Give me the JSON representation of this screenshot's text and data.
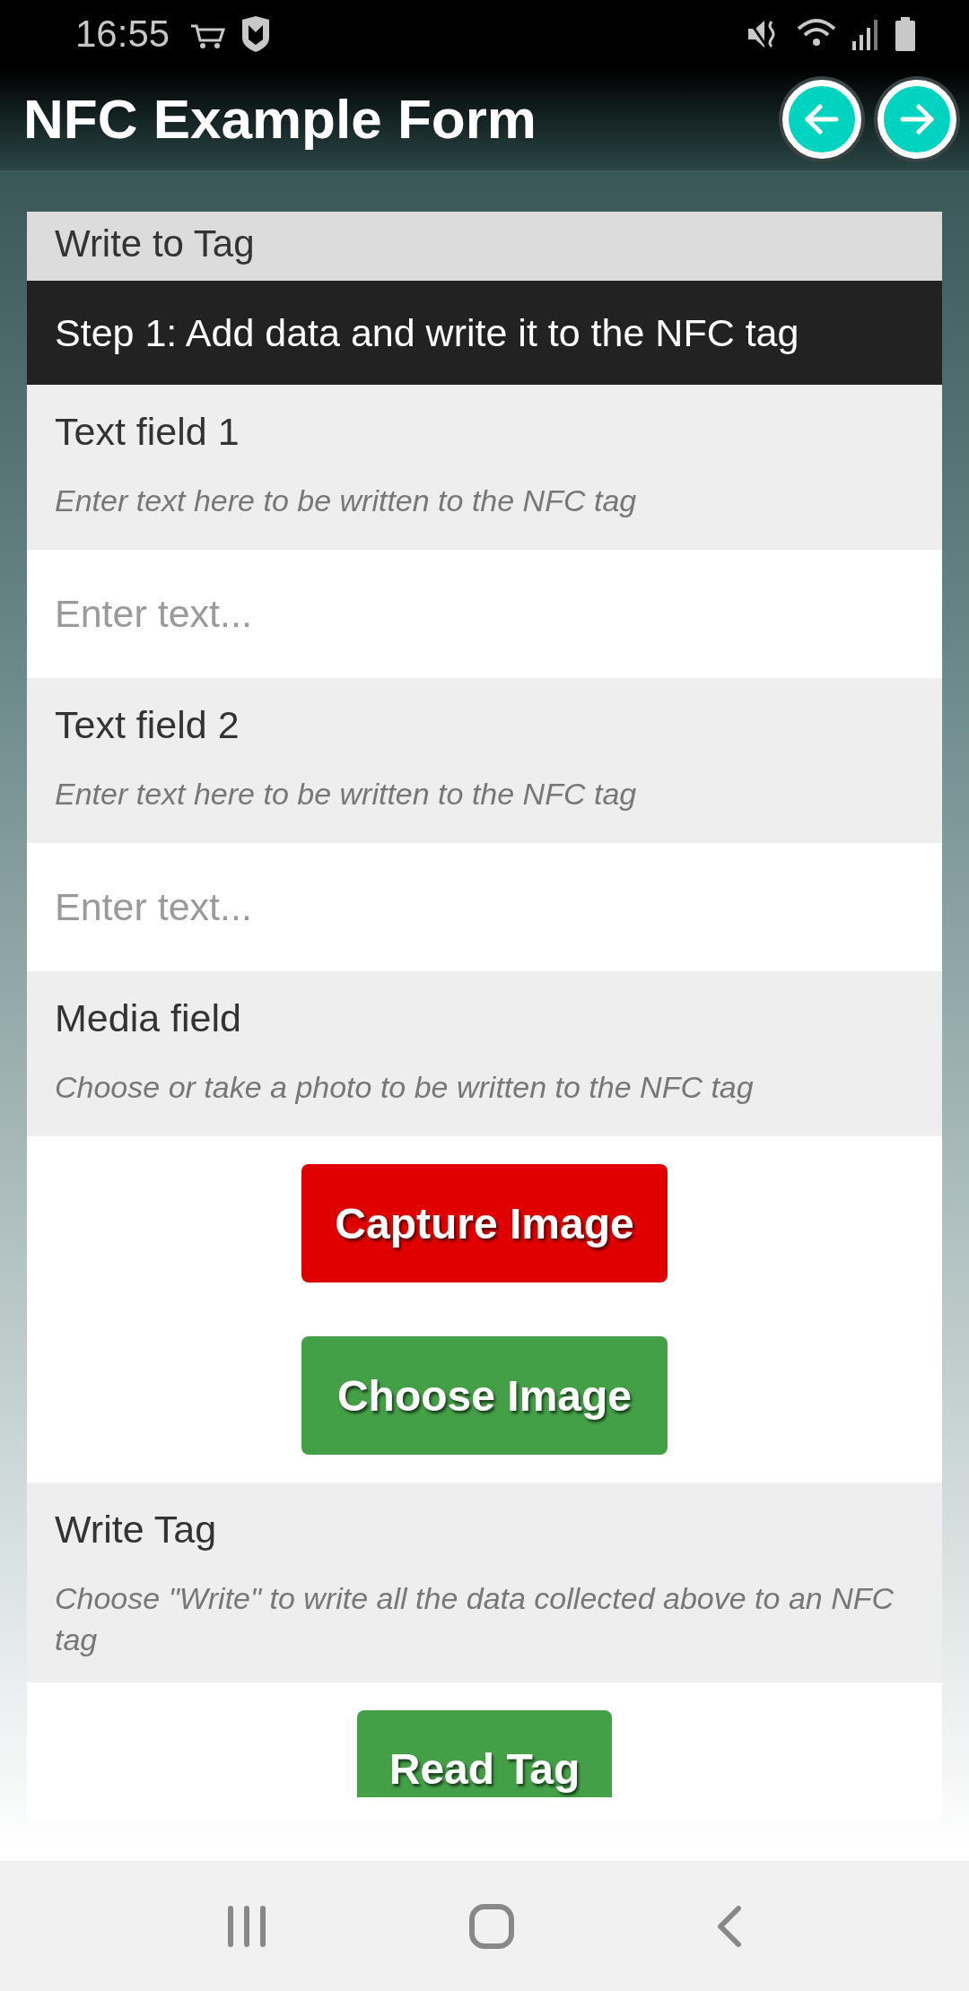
{
  "status_bar": {
    "time": "16:55"
  },
  "app_bar": {
    "title": "NFC Example Form",
    "buttons": [
      {
        "kind": "back"
      },
      {
        "kind": "forward"
      }
    ]
  },
  "form": {
    "title": "Write to Tag",
    "step": "Step 1: Add data and write it to the NFC tag",
    "fields": [
      {
        "kind": "text",
        "label": "Text field 1",
        "hint": "Enter text here to be written to the NFC tag",
        "placeholder": "Enter text..."
      },
      {
        "kind": "text",
        "label": "Text field 2",
        "hint": "Enter text here to be written to the NFC tag",
        "placeholder": "Enter text..."
      },
      {
        "kind": "media",
        "label": "Media field",
        "hint": "Choose or take a photo to be written to the NFC tag",
        "buttons": [
          {
            "label": "Capture Image",
            "color": "#e00000"
          },
          {
            "label": "Choose Image",
            "color": "#43a047"
          }
        ]
      },
      {
        "kind": "action",
        "label": "Write Tag",
        "hint": "Choose \"Write\" to write all the data collected above to an NFC tag",
        "buttons": [
          {
            "label": "Read Tag",
            "color": "#43a047"
          }
        ]
      }
    ]
  },
  "nav_bar": {
    "buttons": [
      {
        "kind": "recent"
      },
      {
        "kind": "home"
      },
      {
        "kind": "back"
      }
    ]
  }
}
